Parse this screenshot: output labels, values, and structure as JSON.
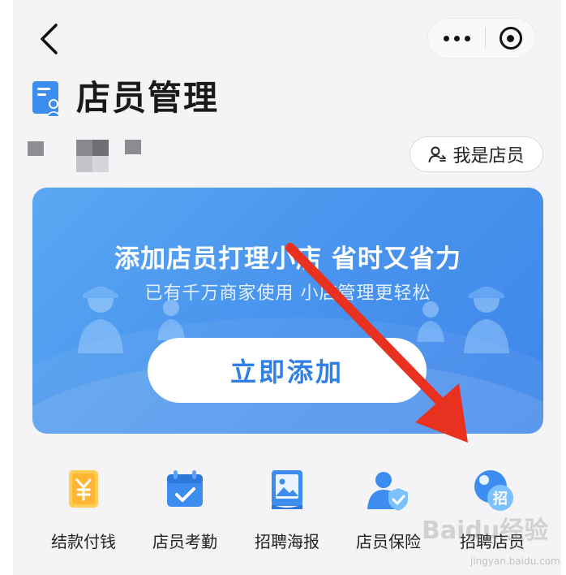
{
  "header": {
    "title": "店员管理"
  },
  "staff_button": {
    "label": "我是店员"
  },
  "banner": {
    "title": "添加店员打理小店 省时又省力",
    "subtitle": "已有千万商家使用 小店管理更轻松",
    "button_label": "立即添加"
  },
  "menu": [
    {
      "label": "结款付钱",
      "icon": "payment-icon"
    },
    {
      "label": "店员考勤",
      "icon": "calendar-check-icon"
    },
    {
      "label": "招聘海报",
      "icon": "poster-icon"
    },
    {
      "label": "店员保险",
      "icon": "insurance-icon"
    },
    {
      "label": "招聘店员",
      "icon": "recruit-icon"
    }
  ],
  "watermark": {
    "text": "Baidu经验",
    "url": "jingyan.baidu.com"
  },
  "colors": {
    "accent": "#2f7fe6",
    "banner": "#4a95ee",
    "arrow": "#e8321f"
  }
}
